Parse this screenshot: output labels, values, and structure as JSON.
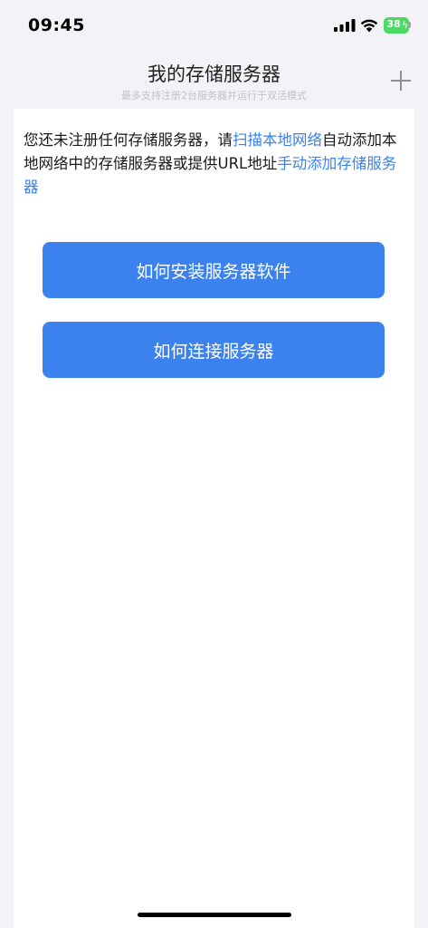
{
  "status_bar": {
    "time": "09:45",
    "battery_percent": "38",
    "battery_color": "#4cd964"
  },
  "header": {
    "title": "我的存储服务器",
    "subtitle": "最多支持注册2台服务器并运行于双活模式",
    "add_icon": "plus-icon"
  },
  "intro": {
    "text_1": "您还未注册任何存储服务器，请",
    "link_scan": "扫描本地网络",
    "text_2": "自动添加本地网络中的存储服务器或提供URL地址",
    "link_manual": "手动添加存储服务器"
  },
  "buttons": {
    "install": "如何安装服务器软件",
    "connect": "如何连接服务器"
  },
  "colors": {
    "accent": "#3c82ee",
    "link": "#3a82ee",
    "background": "#f2f2f7"
  }
}
